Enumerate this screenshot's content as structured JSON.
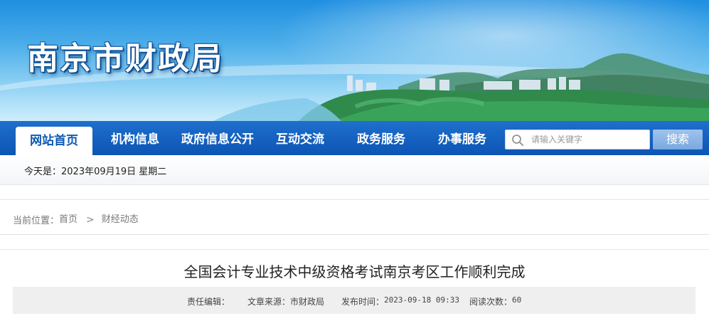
{
  "header": {
    "site_title": "南京市财政局"
  },
  "nav": {
    "items": [
      {
        "label": "网站首页",
        "active": true
      },
      {
        "label": "机构信息",
        "active": false
      },
      {
        "label": "政府信息公开",
        "active": false
      },
      {
        "label": "互动交流",
        "active": false
      },
      {
        "label": "政务服务",
        "active": false
      },
      {
        "label": "办事服务",
        "active": false
      }
    ],
    "search_placeholder": "请输入关键字",
    "search_button": "搜索"
  },
  "datebar": {
    "text": "今天是：2023年09月19日 星期二"
  },
  "breadcrumb": {
    "prefix": "当前位置：",
    "home": "首页",
    "separator": ">",
    "current": "财经动态"
  },
  "article": {
    "title": "全国会计专业技术中级资格考试南京考区工作顺利完成",
    "meta": {
      "editor_label": "责任编辑：",
      "source_label": "文章来源：",
      "source_value": "市财政局",
      "publish_label": "发布时间：",
      "publish_value": "2023-09-18 09:33",
      "views_label": "阅读次数：",
      "views_value": "60"
    }
  },
  "colors": {
    "nav_bg": "#0c55b4",
    "active_tab_text": "#0d5ab6",
    "search_button_bg": "#7aa9e0"
  }
}
